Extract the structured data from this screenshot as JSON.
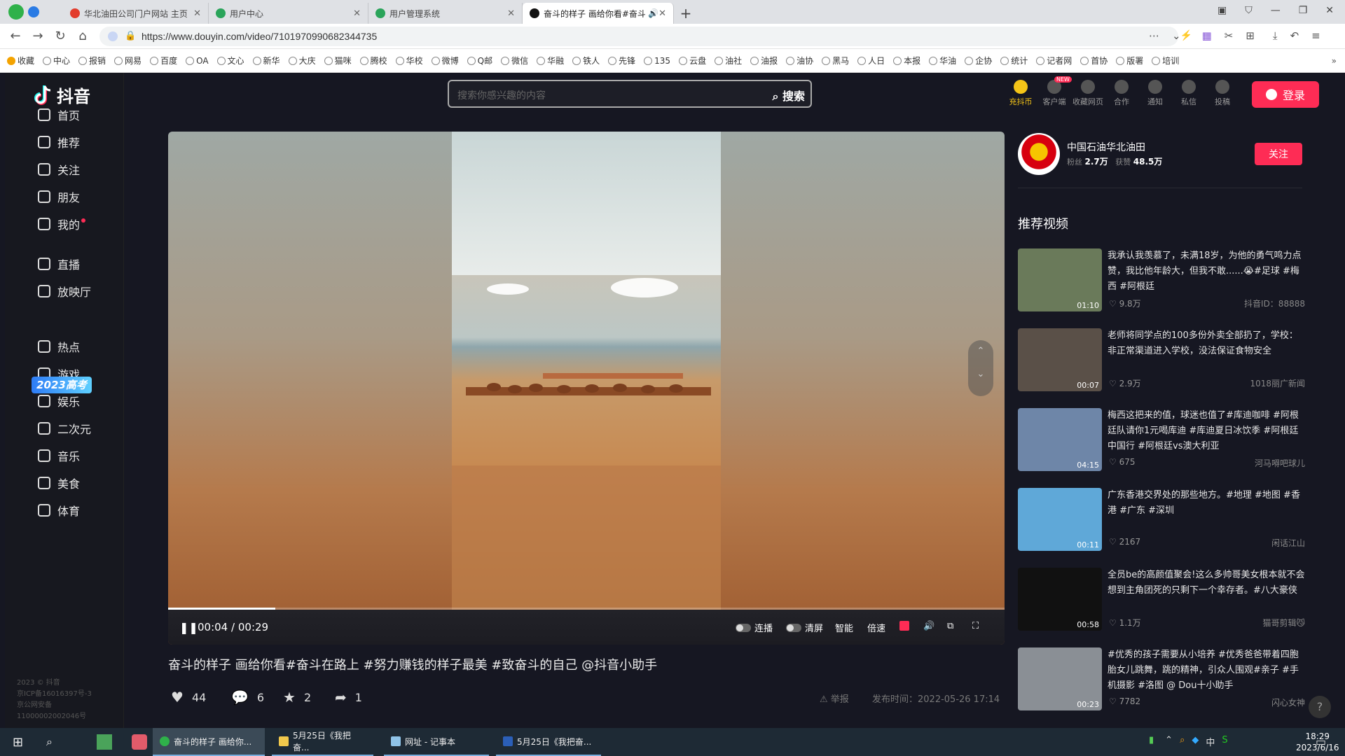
{
  "browser": {
    "tabs": [
      {
        "title": "华北油田公司门户网站 主页",
        "color": "#e23c2c"
      },
      {
        "title": "用户中心",
        "color": "#2aa45a"
      },
      {
        "title": "用户管理系统",
        "color": "#2aa45a"
      },
      {
        "title": "奋斗的样子 画给你看#奋斗...",
        "color": "#111111"
      }
    ],
    "new_tab": "+",
    "url": "https://www.douyin.com/video/7101970990682344735",
    "bookmarks": [
      "收藏",
      "中心",
      "报销",
      "网易",
      "百度",
      "OA",
      "文心",
      "新华",
      "大庆",
      "猫咪",
      "腾校",
      "华校",
      "微博",
      "Q邮",
      "微信",
      "华融",
      "铁人",
      "先锋",
      "135",
      "云盘",
      "油社",
      "油报",
      "油协",
      "黑马",
      "人日",
      "本报",
      "华油",
      "企协",
      "统计",
      "记者网",
      "首协",
      "版署",
      "培训"
    ]
  },
  "douyin": {
    "logo_text": "抖音",
    "search_placeholder": "搜索你感兴趣的内容",
    "search_button": "搜索",
    "top_icons": [
      "充抖币",
      "客户端",
      "收藏网页",
      "合作",
      "通知",
      "私信",
      "投稿"
    ],
    "new_badge": "NEW",
    "login_label": "登录",
    "nav": [
      {
        "label": "首页",
        "icon": "home-icon"
      },
      {
        "label": "推荐",
        "icon": "thumbs-up-icon"
      },
      {
        "label": "关注",
        "icon": "user-plus-icon"
      },
      {
        "label": "朋友",
        "icon": "friends-icon"
      },
      {
        "label": "我的",
        "icon": "user-icon"
      },
      {
        "label": "直播",
        "icon": "live-icon"
      },
      {
        "label": "放映厅",
        "icon": "tv-icon"
      },
      {
        "label": "热点",
        "icon": "flame-icon"
      },
      {
        "label": "游戏",
        "icon": "gamepad-icon"
      },
      {
        "label": "娱乐",
        "icon": "smile-icon"
      },
      {
        "label": "二次元",
        "icon": "anime-icon"
      },
      {
        "label": "音乐",
        "icon": "music-icon"
      },
      {
        "label": "美食",
        "icon": "food-icon"
      },
      {
        "label": "体育",
        "icon": "sports-icon"
      }
    ],
    "gaokao_banner": "2023高考",
    "footer": [
      "2023 © 抖音",
      "京ICP备16016397号-3",
      "京公网安备",
      "11000002002046号"
    ]
  },
  "video": {
    "time_current": "00:04",
    "time_separator": "/",
    "time_total": "00:29",
    "progress_fraction": 0.128,
    "controls": [
      "连播",
      "清屏",
      "智能",
      "倍速"
    ],
    "title": "奋斗的样子 画给你看#奋斗在路上 #努力赚钱的样子最美 #致奋斗的自己 @抖音小助手",
    "likes": "44",
    "comments": "6",
    "favorites": "2",
    "shares": "1",
    "report_label": "举报",
    "publish_time": "发布时间：2022-05-26 17:14"
  },
  "author": {
    "name": "中国石油华北油田",
    "fans_label": "粉丝",
    "fans": "2.7万",
    "likes_label": "获赞",
    "likes": "48.5万",
    "follow_label": "关注"
  },
  "recommend": {
    "title": "推荐视频",
    "items": [
      {
        "text": "我承认我羡慕了，未满18岁，为他的勇气鸣力点赞，我比他年龄大，但我不敢......😭#足球 #梅西 #阿根廷",
        "duration": "01:10",
        "likes": "9.8万",
        "author": "抖音ID：88888",
        "thumb": "#6a7a5a"
      },
      {
        "text": "老师将同学点的100多份外卖全部扔了，学校：非正常渠道进入学校，没法保证食物安全",
        "duration": "00:07",
        "likes": "2.9万",
        "author": "1018丽广新闻",
        "thumb": "#5a5048"
      },
      {
        "text": "梅西这把来的值，球迷也值了#库迪咖啡 #阿根廷队请你1元喝库迪 #库迪夏日冰饮季 #阿根廷中国行 #阿根廷vs澳大利亚",
        "duration": "04:15",
        "likes": "675",
        "author": "河马嘚吧球儿",
        "thumb": "#6e86a8"
      },
      {
        "text": "广东香港交界处的那些地方。#地理 #地图 #香港 #广东 #深圳",
        "duration": "00:11",
        "likes": "2167",
        "author": "闲话江山",
        "thumb": "#5fa8d8"
      },
      {
        "text": "全员be的高颜值聚会!这么多帅哥美女根本就不会想到主角团死的只剩下一个幸存者。#八大豪侠",
        "duration": "00:58",
        "likes": "1.1万",
        "author": "猫哥剪辑😼",
        "thumb": "#111111"
      },
      {
        "text": "#优秀的孩子需要从小培养 #优秀爸爸带着四胞胎女儿跳舞，跳的精神，引众人围观#亲子 #手机摄影 #洛图 @ Dou十小助手",
        "duration": "00:23",
        "likes": "7782",
        "author": "闪心女神",
        "thumb": "#8a8f95"
      }
    ]
  },
  "taskbar": {
    "items": [
      "奋斗的样子 画给你...",
      "5月25日《我把奋...",
      "网址 - 记事本",
      "5月25日《我把奋..."
    ],
    "time": "18:29",
    "date": "2023/6/16",
    "ime": "中"
  }
}
